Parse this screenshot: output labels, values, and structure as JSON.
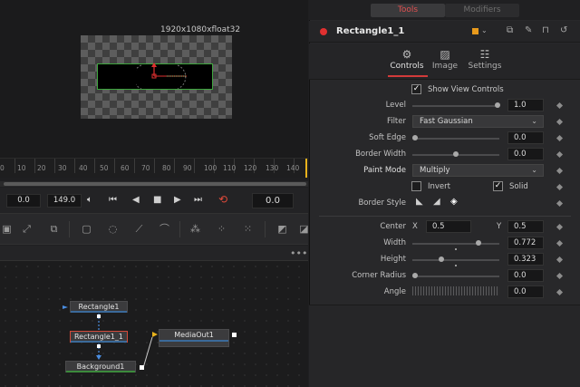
{
  "viewer": {
    "resolution_label": "1920x1080xfloat32"
  },
  "timeline": {
    "ticks": [
      "0",
      "10",
      "20",
      "30",
      "40",
      "50",
      "60",
      "70",
      "80",
      "90",
      "100",
      "110",
      "120",
      "130",
      "140"
    ],
    "current_frame": "0.0",
    "end_frame": "149.0",
    "current_time": "0.0"
  },
  "nodes": {
    "rectangle1": "Rectangle1",
    "rectangle1_1": "Rectangle1_1",
    "background1": "Background1",
    "mediaout1": "MediaOut1"
  },
  "inspector": {
    "tabs": {
      "tools": "Tools",
      "modifiers": "Modifiers"
    },
    "node_title": "Rectangle1_1",
    "subtabs": {
      "controls": "Controls",
      "image": "Image",
      "settings": "Settings"
    },
    "show_view_controls": {
      "label": "Show View Controls",
      "checked": true
    },
    "level": {
      "label": "Level",
      "value": "1.0"
    },
    "filter": {
      "label": "Filter",
      "value": "Fast Gaussian"
    },
    "soft_edge": {
      "label": "Soft Edge",
      "value": "0.0"
    },
    "border_width": {
      "label": "Border Width",
      "value": "0.0"
    },
    "paint_mode": {
      "label": "Paint Mode",
      "value": "Multiply"
    },
    "invert": {
      "label": "Invert",
      "checked": false
    },
    "solid": {
      "label": "Solid",
      "checked": true
    },
    "border_style": {
      "label": "Border Style"
    },
    "center": {
      "label": "Center",
      "x_label": "X",
      "x_value": "0.5",
      "y_label": "Y",
      "y_value": "0.5"
    },
    "width": {
      "label": "Width",
      "value": "0.772"
    },
    "height": {
      "label": "Height",
      "value": "0.323"
    },
    "corner_radius": {
      "label": "Corner Radius",
      "value": "0.0"
    },
    "angle": {
      "label": "Angle",
      "value": "0.0"
    }
  },
  "colors": {
    "accent_red": "#d23a3a",
    "node_selected_border": "#d24a3a",
    "rect_outline": "#3ea63e",
    "playhead": "#e8b21c"
  }
}
